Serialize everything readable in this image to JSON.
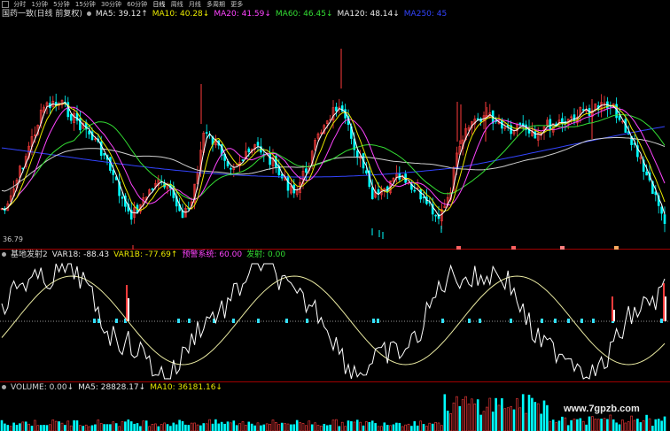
{
  "toolbar": {
    "tabs": [
      "分时",
      "1分钟",
      "5分钟",
      "15分钟",
      "30分钟",
      "60分钟",
      "日线",
      "周线",
      "月线",
      "多周期",
      "更多"
    ],
    "active_tab": "日线"
  },
  "main_panel": {
    "title": "国药一致(日线 前复权)",
    "ma": [
      {
        "label": "MA5: 39.12↑",
        "color": "#e8e8e8"
      },
      {
        "label": "MA10: 40.28↓",
        "color": "#e8e800"
      },
      {
        "label": "MA20: 41.59↓",
        "color": "#ff44ff"
      },
      {
        "label": "MA60: 46.45↓",
        "color": "#33dd33"
      },
      {
        "label": "MA120: 48.14↓",
        "color": "#e8e8e8"
      },
      {
        "label": "MA250: 45",
        "color": "#3344ff"
      }
    ],
    "price_low": "36.79"
  },
  "indicator_panel": {
    "title": "基地发射2",
    "values": [
      {
        "label": "VAR18: -88.43",
        "color": "#e8e8e8"
      },
      {
        "label": "VAR1B: -77.69↑",
        "color": "#e8e800"
      },
      {
        "label": "预警系统: 60.00",
        "color": "#ff44ff"
      },
      {
        "label": "发射: 0.00",
        "color": "#33dd33"
      }
    ]
  },
  "volume_panel": {
    "title": "VOLUME: 0.00↓",
    "values": [
      {
        "label": "MA5: 28828.17↓",
        "color": "#e8e8e8"
      },
      {
        "label": "MA10: 36181.16↓",
        "color": "#e8e800"
      }
    ]
  },
  "watermark": "www.7gpzb.com",
  "colors": {
    "up": "#ff3c3c",
    "down": "#00ffff",
    "background": "#000000",
    "grid": "#a00000"
  }
}
